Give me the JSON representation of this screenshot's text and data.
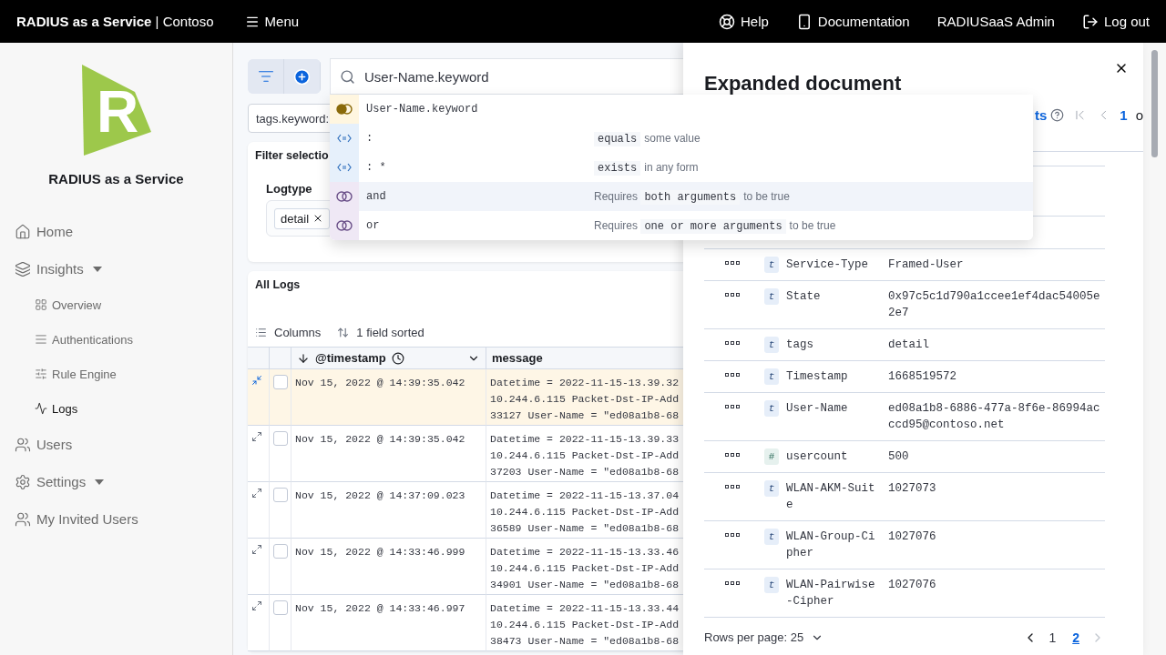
{
  "topbar": {
    "brand": "RADIUS as a Service",
    "separator": "|",
    "org": "Contoso",
    "menu": "Menu",
    "links": [
      {
        "kind": "help",
        "label": "Help"
      },
      {
        "kind": "docs",
        "label": "Documentation"
      },
      {
        "kind": "plain",
        "label": "RADIUSaaS Admin"
      },
      {
        "kind": "logout",
        "label": "Log out"
      }
    ]
  },
  "sidebar": {
    "logo_letter": "R",
    "title": "RADIUS as a Service",
    "items": [
      {
        "label": "Home",
        "selected": false
      },
      {
        "label": "Insights",
        "selected": false,
        "has_menu": true,
        "children": [
          {
            "label": "Overview",
            "selected": false
          },
          {
            "label": "Authentications",
            "selected": false
          },
          {
            "label": "Rule Engine",
            "selected": false
          },
          {
            "label": "Logs",
            "selected": true
          }
        ]
      },
      {
        "label": "Users",
        "selected": false
      },
      {
        "label": "Settings",
        "selected": false,
        "has_menu": true
      },
      {
        "label": "My Invited Users",
        "selected": false
      }
    ]
  },
  "query": {
    "value": "User-Name.keyword",
    "filter_pill": "tags.keyword:"
  },
  "suggestions": [
    {
      "kind": "field",
      "label": "User-Name.keyword",
      "selected": false
    },
    {
      "kind": "operator",
      "label": ":",
      "code": "equals",
      "text": "some value",
      "selected": false
    },
    {
      "kind": "operator",
      "label": ": *",
      "code": "exists",
      "text": "in any form",
      "selected": false
    },
    {
      "kind": "conjunction",
      "label": "and",
      "lead": "Requires",
      "code": "both arguments",
      "text": "to be true",
      "selected": true
    },
    {
      "kind": "conjunction",
      "label": "or",
      "lead": "Requires",
      "code": "one or more arguments",
      "text": "to be true",
      "selected": false
    }
  ],
  "filter_panel": {
    "title": "Filter selectio",
    "label": "Logtype",
    "chips": [
      "detail"
    ]
  },
  "logs": {
    "title": "All Logs",
    "columns_button": "Columns",
    "sort_button": "1 field sorted",
    "columns": [
      "@timestamp",
      "message"
    ],
    "rows": [
      {
        "selected": true,
        "checked": false,
        "timestamp": "Nov 15, 2022 @ 14:39:35.042",
        "message": [
          "Datetime = 2022-11-15-13.39.32",
          "10.244.6.115 Packet-Dst-IP-Add",
          "33127 User-Name = \"ed08a1b8-68"
        ]
      },
      {
        "selected": false,
        "checked": false,
        "timestamp": "Nov 15, 2022 @ 14:39:35.042",
        "message": [
          "Datetime = 2022-11-15-13.39.33",
          "10.244.6.115 Packet-Dst-IP-Add",
          "37203 User-Name = \"ed08a1b8-68"
        ]
      },
      {
        "selected": false,
        "checked": false,
        "timestamp": "Nov 15, 2022 @ 14:37:09.023",
        "message": [
          "Datetime = 2022-11-15-13.37.04",
          "10.244.6.115 Packet-Dst-IP-Add",
          "36589 User-Name = \"ed08a1b8-68"
        ]
      },
      {
        "selected": false,
        "checked": false,
        "timestamp": "Nov 15, 2022 @ 14:33:46.999",
        "message": [
          "Datetime = 2022-11-15-13.33.46",
          "10.244.6.115 Packet-Dst-IP-Add",
          "34901 User-Name = \"ed08a1b8-68"
        ]
      },
      {
        "selected": false,
        "checked": false,
        "timestamp": "Nov 15, 2022 @ 14:33:46.997",
        "message": [
          "Datetime = 2022-11-15-13.33.44",
          "10.244.6.115 Packet-Dst-IP-Add",
          "38473 User-Name = \"ed08a1b8-68"
        ]
      }
    ]
  },
  "flyout": {
    "title": "Expanded document",
    "link": "ts",
    "page": "1",
    "page_tail": "o",
    "fields": [
      {
        "kind": "string",
        "badge": "t",
        "name": "Service-Type",
        "value": "Framed-User"
      },
      {
        "kind": "string",
        "badge": "t",
        "name": "State",
        "value": "0x97c5c1d790a1ccee1ef4dac54005e2e7"
      },
      {
        "kind": "string",
        "badge": "t",
        "name": "tags",
        "value": "detail"
      },
      {
        "kind": "string",
        "badge": "t",
        "name": "Timestamp",
        "value": "1668519572"
      },
      {
        "kind": "string",
        "badge": "t",
        "name": "User-Name",
        "value": "ed08a1b8-6886-477a-8f6e-86994acccd95@contoso.net"
      },
      {
        "kind": "number",
        "badge": "#",
        "name": "usercount",
        "value": "500"
      },
      {
        "kind": "string",
        "badge": "t",
        "name": "WLAN-AKM-Suite",
        "value": "1027073"
      },
      {
        "kind": "string",
        "badge": "t",
        "name": "WLAN-Group-Cipher",
        "value": "1027076"
      },
      {
        "kind": "string",
        "badge": "t",
        "name": "WLAN-Pairwise-Cipher",
        "value": "1027076"
      }
    ],
    "rows_per_page": "Rows per page: 25",
    "pages": [
      {
        "label": "1",
        "selected": false
      },
      {
        "label": "2",
        "selected": true
      }
    ]
  }
}
